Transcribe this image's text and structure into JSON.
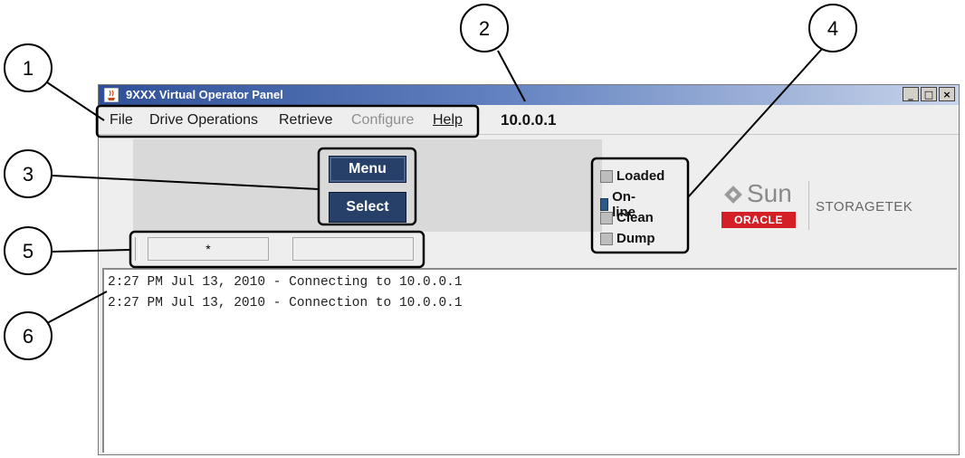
{
  "window": {
    "title": "9XXX Virtual Operator Panel",
    "controls": {
      "minimize": "_",
      "maximize": "□",
      "close": "×"
    }
  },
  "menu": {
    "items": [
      {
        "label": "File",
        "state": "enabled"
      },
      {
        "label": "Drive Operations",
        "state": "enabled"
      },
      {
        "label": "Retrieve",
        "state": "enabled"
      },
      {
        "label": "Configure",
        "state": "disabled"
      },
      {
        "label": "Help",
        "state": "enabled",
        "underlined": true
      }
    ],
    "ip_address": "10.0.0.1"
  },
  "panel": {
    "menu_button": "Menu",
    "select_button": "Select",
    "display_left": "*",
    "display_right": ""
  },
  "indicators": [
    {
      "label": "Loaded",
      "state": "off"
    },
    {
      "label": "On-line",
      "state": "on"
    },
    {
      "label": "Clean",
      "state": "off"
    },
    {
      "label": "Dump",
      "state": "off"
    }
  ],
  "branding": {
    "sun": "Sun",
    "oracle": "ORACLE",
    "storagetek": "STORAGETEK"
  },
  "log": [
    "2:27 PM Jul 13, 2010 - Connecting to 10.0.0.1",
    "2:27 PM Jul 13, 2010 - Connection to 10.0.0.1"
  ],
  "callouts": [
    "1",
    "2",
    "3",
    "4",
    "5",
    "6"
  ],
  "colors": {
    "titlebar": "#2f4f98",
    "button": "#27406a",
    "led_on": "#2a5a86",
    "oracle_red": "#d51f26"
  }
}
